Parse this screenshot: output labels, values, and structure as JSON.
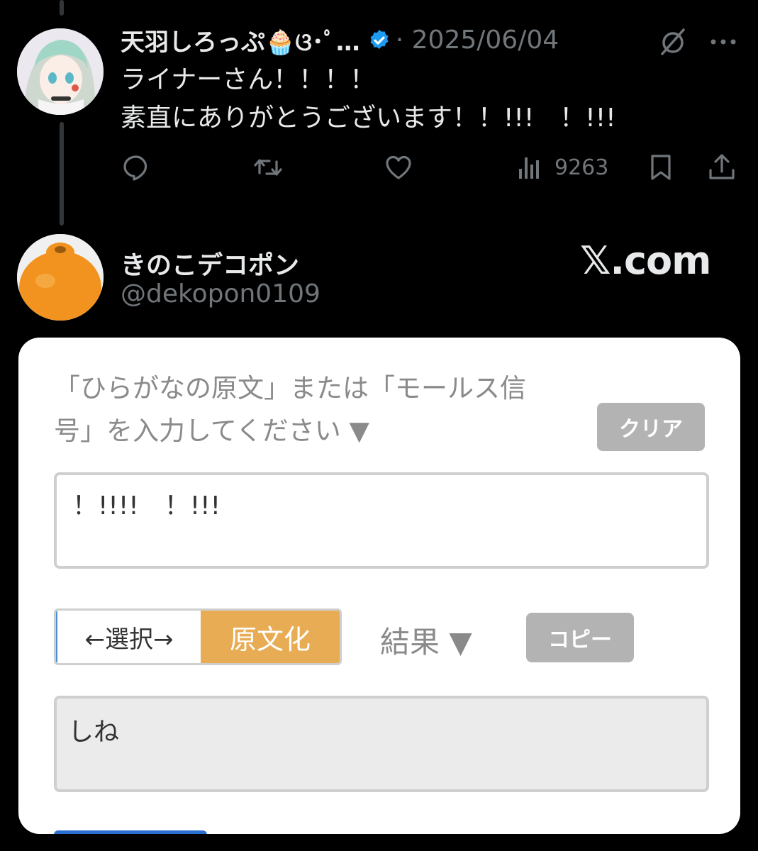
{
  "reply_tweet": {
    "display_name": "天羽しろっぷ🧁ଓ･ﾟ…",
    "date": "· 2025/06/04",
    "text_line1": "ライナーさん！！！！",
    "text_line2": "素直にありがとうございます！！!!!　！!!!",
    "actions": {
      "reply_icon": "reply-icon",
      "retweet_icon": "retweet-icon",
      "like_icon": "heart-icon",
      "views_icon": "views-chart-icon",
      "views_count": "9263",
      "bookmark_icon": "bookmark-icon",
      "share_icon": "share-icon"
    }
  },
  "quoted_account": {
    "display_name": "きのこデコポン",
    "handle": "@dekopon0109",
    "site": "𝕏.com"
  },
  "converter": {
    "instruction": "「ひらがなの原文」または「モールス信号」を入力してください ▼",
    "clear_button": "クリア",
    "input_value": "！!!!!　！!!!",
    "select_label": "←選択→",
    "convert_label": "原文化",
    "result_label": "結果 ▼",
    "copy_button": "コピー",
    "output_value": "しね"
  },
  "colors": {
    "background": "#000000",
    "verified_blue": "#1d9bf0",
    "accent_orange": "#e8ac54",
    "secondary_text": "#71767b"
  }
}
